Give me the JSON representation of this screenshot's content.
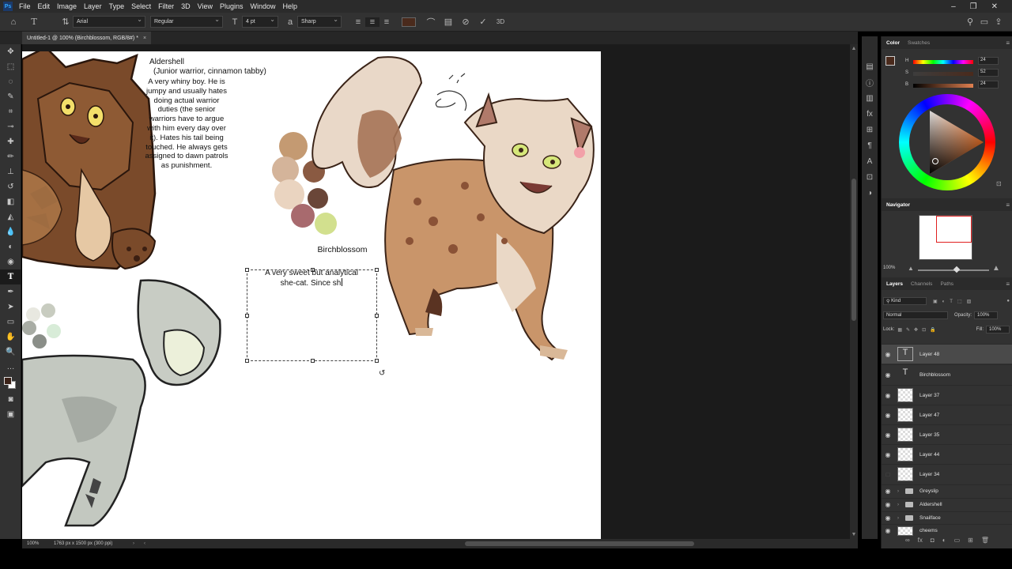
{
  "menubar": {
    "logo": "Ps",
    "items": [
      "File",
      "Edit",
      "Image",
      "Layer",
      "Type",
      "Select",
      "Filter",
      "3D",
      "View",
      "Plugins",
      "Window",
      "Help"
    ],
    "window_controls": [
      "–",
      "❐",
      "✕"
    ]
  },
  "options_bar": {
    "font_family": "Arial",
    "font_style": "Regular",
    "font_size": "4 pt",
    "antialias": "Sharp",
    "text_color": "#4a2a1c"
  },
  "document_tab": {
    "title": "Untitled-1 @ 100% (Birchblossom, RGB/8#) *",
    "close": "×"
  },
  "canvas_text": {
    "aldershell_name": "Aldershell",
    "aldershell_role": "(Junior warrior, cinnamon tabby)",
    "aldershell_desc": "A very whiny boy. He is jumpy and usually hates doing actual warrior duties (the senior warriors have to argue with him every day over it). Hates his tail being touched. He always gets assigned to dawn patrols as punishment.",
    "birchblossom_name": "Birchblossom",
    "typing_line1": "A very sweet but analytical",
    "typing_line2": "she-cat. Since sh"
  },
  "palette_colors": [
    "#c49a72",
    "#d4b49a",
    "#8a5a42",
    "#ead4c0",
    "#6a4638",
    "#a86a6e",
    "#d2e08e"
  ],
  "grey_palette": [
    "#e8e8e0",
    "#c8ccc0",
    "#a8aca4",
    "#8a8e88",
    "#d8ecd8"
  ],
  "status_bar": {
    "zoom": "100%",
    "doc_info": "1763 px x 1500 px (300 ppi)"
  },
  "color_panel": {
    "tabs": [
      "Color",
      "Swatches"
    ],
    "sliders": [
      {
        "label": "H",
        "value": "24"
      },
      {
        "label": "S",
        "value": "52"
      },
      {
        "label": "B",
        "value": "24"
      }
    ]
  },
  "navigator": {
    "title": "Navigator",
    "zoom": "100%"
  },
  "layers_panel": {
    "tabs": [
      "Layers",
      "Channels",
      "Paths"
    ],
    "filter_placeholder": "Kind",
    "blend_mode": "Normal",
    "opacity_label": "Opacity:",
    "opacity": "100%",
    "lock_label": "Lock:",
    "fill_label": "Fill:",
    "fill": "100%",
    "layers": [
      {
        "name": "Layer 48",
        "type": "text",
        "selected": true
      },
      {
        "name": "Birchblossom",
        "type": "text"
      },
      {
        "name": "Layer 37",
        "type": "pixel"
      },
      {
        "name": "Layer 47",
        "type": "pixel"
      },
      {
        "name": "Layer 35",
        "type": "pixel"
      },
      {
        "name": "Layer 44",
        "type": "pixel"
      },
      {
        "name": "Layer 34",
        "type": "pixel",
        "hidden": true
      }
    ],
    "groups": [
      "Greyslip",
      "Aldershell",
      "Snailface"
    ],
    "last_layer": "cheems"
  }
}
